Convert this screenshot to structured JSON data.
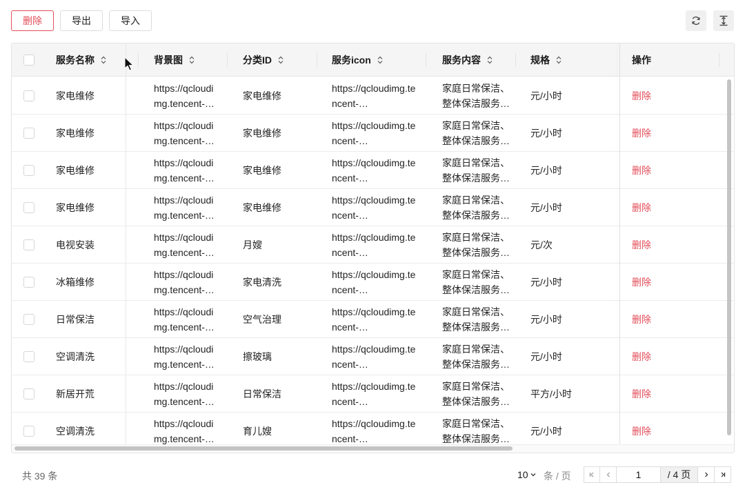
{
  "toolbar": {
    "delete_label": "删除",
    "export_label": "导出",
    "import_label": "导入"
  },
  "tool_icons": [
    "refresh-icon",
    "column-height-icon"
  ],
  "table": {
    "columns": [
      {
        "key": "name",
        "label": "服务名称",
        "sortable": true
      },
      {
        "key": "bg",
        "label": "背景图",
        "sortable": true
      },
      {
        "key": "cat",
        "label": "分类ID",
        "sortable": true
      },
      {
        "key": "icon",
        "label": "服务icon",
        "sortable": true
      },
      {
        "key": "content",
        "label": "服务内容",
        "sortable": true
      },
      {
        "key": "spec",
        "label": "规格",
        "sortable": true
      },
      {
        "key": "op",
        "label": "操作",
        "sortable": false
      }
    ],
    "rows": [
      {
        "name": "家电维修",
        "bg1": "https://qcloudi",
        "bg2": "mg.tencent-…",
        "cat": "家电维修",
        "icon1": "https://qcloudimg.te",
        "icon2": "ncent-…",
        "c1": "家庭日常保洁、",
        "c2": "整体保洁服务…",
        "spec": "元/小时",
        "op": "删除"
      },
      {
        "name": "家电维修",
        "bg1": "https://qcloudi",
        "bg2": "mg.tencent-…",
        "cat": "家电维修",
        "icon1": "https://qcloudimg.te",
        "icon2": "ncent-…",
        "c1": "家庭日常保洁、",
        "c2": "整体保洁服务…",
        "spec": "元/小时",
        "op": "删除"
      },
      {
        "name": "家电维修",
        "bg1": "https://qcloudi",
        "bg2": "mg.tencent-…",
        "cat": "家电维修",
        "icon1": "https://qcloudimg.te",
        "icon2": "ncent-…",
        "c1": "家庭日常保洁、",
        "c2": "整体保洁服务…",
        "spec": "元/小时",
        "op": "删除"
      },
      {
        "name": "家电维修",
        "bg1": "https://qcloudi",
        "bg2": "mg.tencent-…",
        "cat": "家电维修",
        "icon1": "https://qcloudimg.te",
        "icon2": "ncent-…",
        "c1": "家庭日常保洁、",
        "c2": "整体保洁服务…",
        "spec": "元/小时",
        "op": "删除"
      },
      {
        "name": "电视安装",
        "bg1": "https://qcloudi",
        "bg2": "mg.tencent-…",
        "cat": "月嫂",
        "icon1": "https://qcloudimg.te",
        "icon2": "ncent-…",
        "c1": "家庭日常保洁、",
        "c2": "整体保洁服务…",
        "spec": "元/次",
        "op": "删除"
      },
      {
        "name": "冰箱维修",
        "bg1": "https://qcloudi",
        "bg2": "mg.tencent-…",
        "cat": "家电清洗",
        "icon1": "https://qcloudimg.te",
        "icon2": "ncent-…",
        "c1": "家庭日常保洁、",
        "c2": "整体保洁服务…",
        "spec": "元/小时",
        "op": "删除"
      },
      {
        "name": "日常保洁",
        "bg1": "https://qcloudi",
        "bg2": "mg.tencent-…",
        "cat": "空气治理",
        "icon1": "https://qcloudimg.te",
        "icon2": "ncent-…",
        "c1": "家庭日常保洁、",
        "c2": "整体保洁服务…",
        "spec": "元/小时",
        "op": "删除"
      },
      {
        "name": "空调清洗",
        "bg1": "https://qcloudi",
        "bg2": "mg.tencent-…",
        "cat": "擦玻璃",
        "icon1": "https://qcloudimg.te",
        "icon2": "ncent-…",
        "c1": "家庭日常保洁、",
        "c2": "整体保洁服务…",
        "spec": "元/小时",
        "op": "删除"
      },
      {
        "name": "新居开荒",
        "bg1": "https://qcloudi",
        "bg2": "mg.tencent-…",
        "cat": "日常保洁",
        "icon1": "https://qcloudimg.te",
        "icon2": "ncent-…",
        "c1": "家庭日常保洁、",
        "c2": "整体保洁服务…",
        "spec": "平方/小时",
        "op": "删除"
      },
      {
        "name": "空调清洗",
        "bg1": "https://qcloudi",
        "bg2": "mg.tencent-…",
        "cat": "育儿嫂",
        "icon1": "https://qcloudimg.te",
        "icon2": "ncent-…",
        "c1": "家庭日常保洁、",
        "c2": "整体保洁服务…",
        "spec": "元/小时",
        "op": "删除"
      }
    ]
  },
  "footer": {
    "total_text": "共 39 条",
    "page_size": "10",
    "page_size_unit": "条 / 页",
    "current_page": "1",
    "total_pages_text": "/ 4 页"
  },
  "colors": {
    "danger": "#e34d59",
    "header_bg": "#f5f5f5",
    "border": "#e3e3e3"
  }
}
